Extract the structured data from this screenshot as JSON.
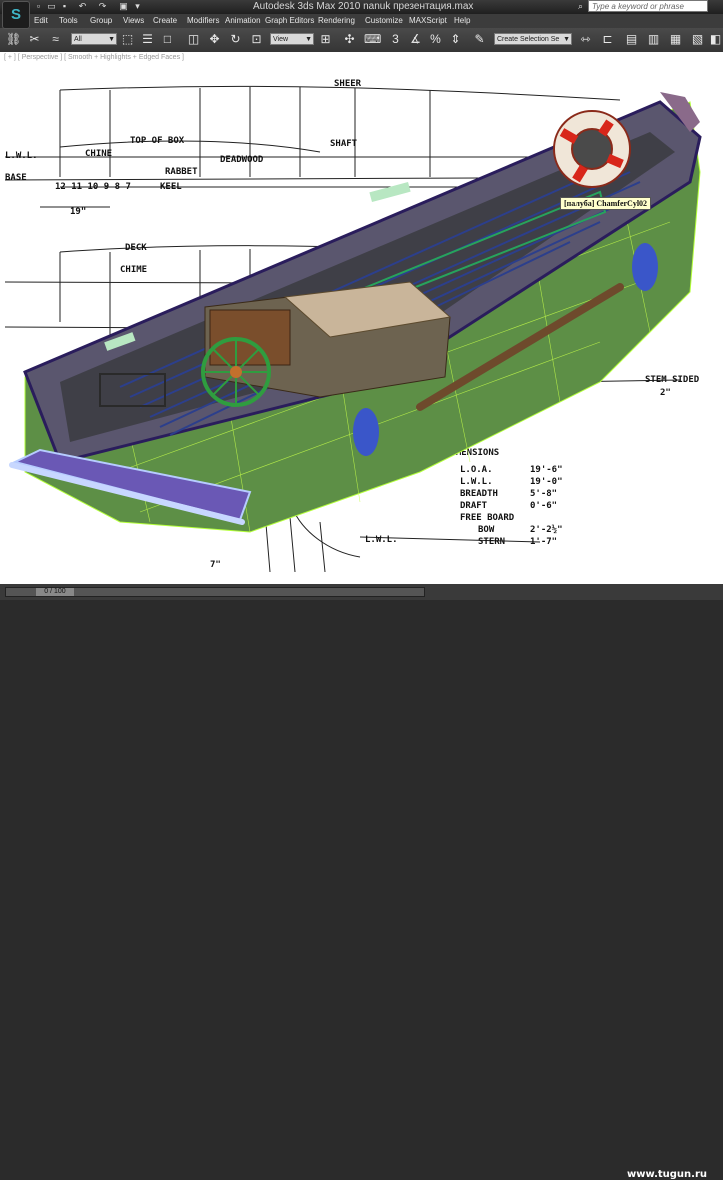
{
  "app": {
    "title": "Autodesk 3ds Max  2010      nanuk презентация.max",
    "search_placeholder": "Type a keyword or phrase"
  },
  "menus": [
    "Edit",
    "Tools",
    "Group",
    "Views",
    "Create",
    "Modifiers",
    "Animation",
    "Graph Editors",
    "Rendering",
    "Customize",
    "MAXScript",
    "Help"
  ],
  "toolbar": {
    "selection_filter": "All",
    "coordinate_system": "View",
    "named_selection": "Create Selection Se"
  },
  "viewport": {
    "label": "[ + ] [ Perspective ] [ Smooth + Highlights + Edged Faces ]",
    "tooltip": "[палуба] ChamferCyl02",
    "blueprint": {
      "sheer": "SHEER",
      "lwl": "L.W.L.",
      "top_of_box": "TOP OF BOX",
      "chine": "CHINE",
      "deadwood": "DEADWOOD",
      "shaft": "SHAFT",
      "rabbet": "RABBET",
      "base": "BASE",
      "keel": "KEEL",
      "station_numbers": "12  11  10  9  8  7",
      "spacing": "19\"",
      "deck": "DECK",
      "chime": "CHIME",
      "stem_sided": "STEM SIDED",
      "stem_value": "2\"",
      "lwl_bottom": "L.W.L.",
      "dim_7": "7\"",
      "dimensions_title": "DIMENSIONS",
      "dimensions": [
        {
          "label": "L.O.A.",
          "value": "19'-6\""
        },
        {
          "label": "L.W.L.",
          "value": "19'-0\""
        },
        {
          "label": "BREADTH",
          "value": "5'-8\""
        },
        {
          "label": "DRAFT",
          "value": "0'-6\""
        },
        {
          "label": "FREE BOARD",
          "value": ""
        },
        {
          "label": "BOW",
          "value": "2'-2½\""
        },
        {
          "label": "STERN",
          "value": "1'-7\""
        }
      ]
    }
  },
  "timeline": {
    "frame": "0 / 100"
  },
  "watermark": "www.tugun.ru"
}
